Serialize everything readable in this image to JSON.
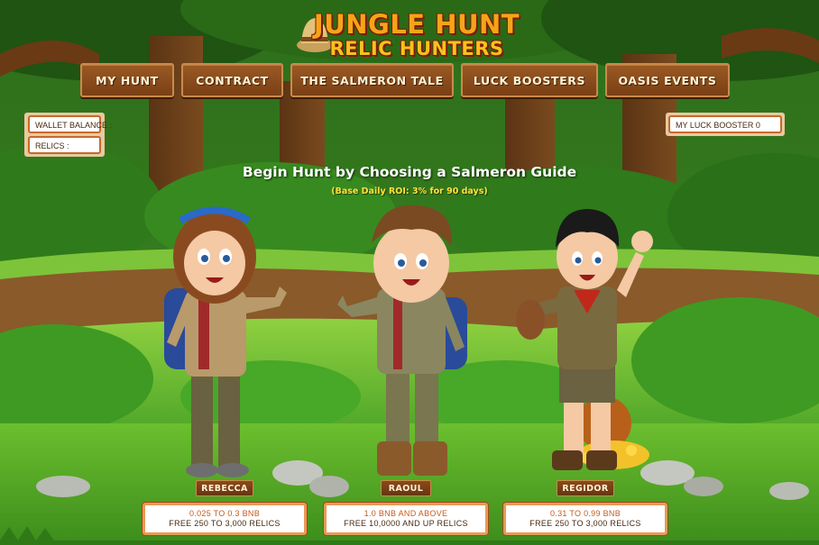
{
  "logo": {
    "line1": "JUNGLE HUNT",
    "line2": "RELIC HUNTERS",
    "icon": "explorer-hat-icon"
  },
  "nav": {
    "items": [
      {
        "label": "MY HUNT"
      },
      {
        "label": "CONTRACT"
      },
      {
        "label": "THE SALMERON TALE"
      },
      {
        "label": "LUCK BOOSTERS"
      },
      {
        "label": "OASIS EVENTS"
      }
    ]
  },
  "wallet": {
    "balance_label": "WALLET BALANCE :",
    "relics_label": "RELICS :"
  },
  "luck_booster": {
    "label": "MY LUCK BOOSTER 0"
  },
  "hero": {
    "title": "Begin Hunt by Choosing a Salmeron Guide",
    "subtitle": "(Base Daily ROI: 3% for 90 days)"
  },
  "guides": [
    {
      "name": "REBECCA",
      "price": "0.025 TO 0.3 BNB",
      "reward": "FREE 250 TO 3,000 RELICS"
    },
    {
      "name": "RAOUL",
      "price": "1.0 BNB AND ABOVE",
      "reward": "FREE 10,0000 AND UP RELICS"
    },
    {
      "name": "REGIDOR",
      "price": "0.31 TO 0.99 BNB",
      "reward": "FREE 250 TO 3,000 RELICS"
    }
  ],
  "colors": {
    "nav_wood": "#8a4a1a",
    "headline": "#ffffff",
    "subline": "#ffe23a",
    "price_accent": "#c65a1a",
    "box_border": "#c56a2c"
  }
}
